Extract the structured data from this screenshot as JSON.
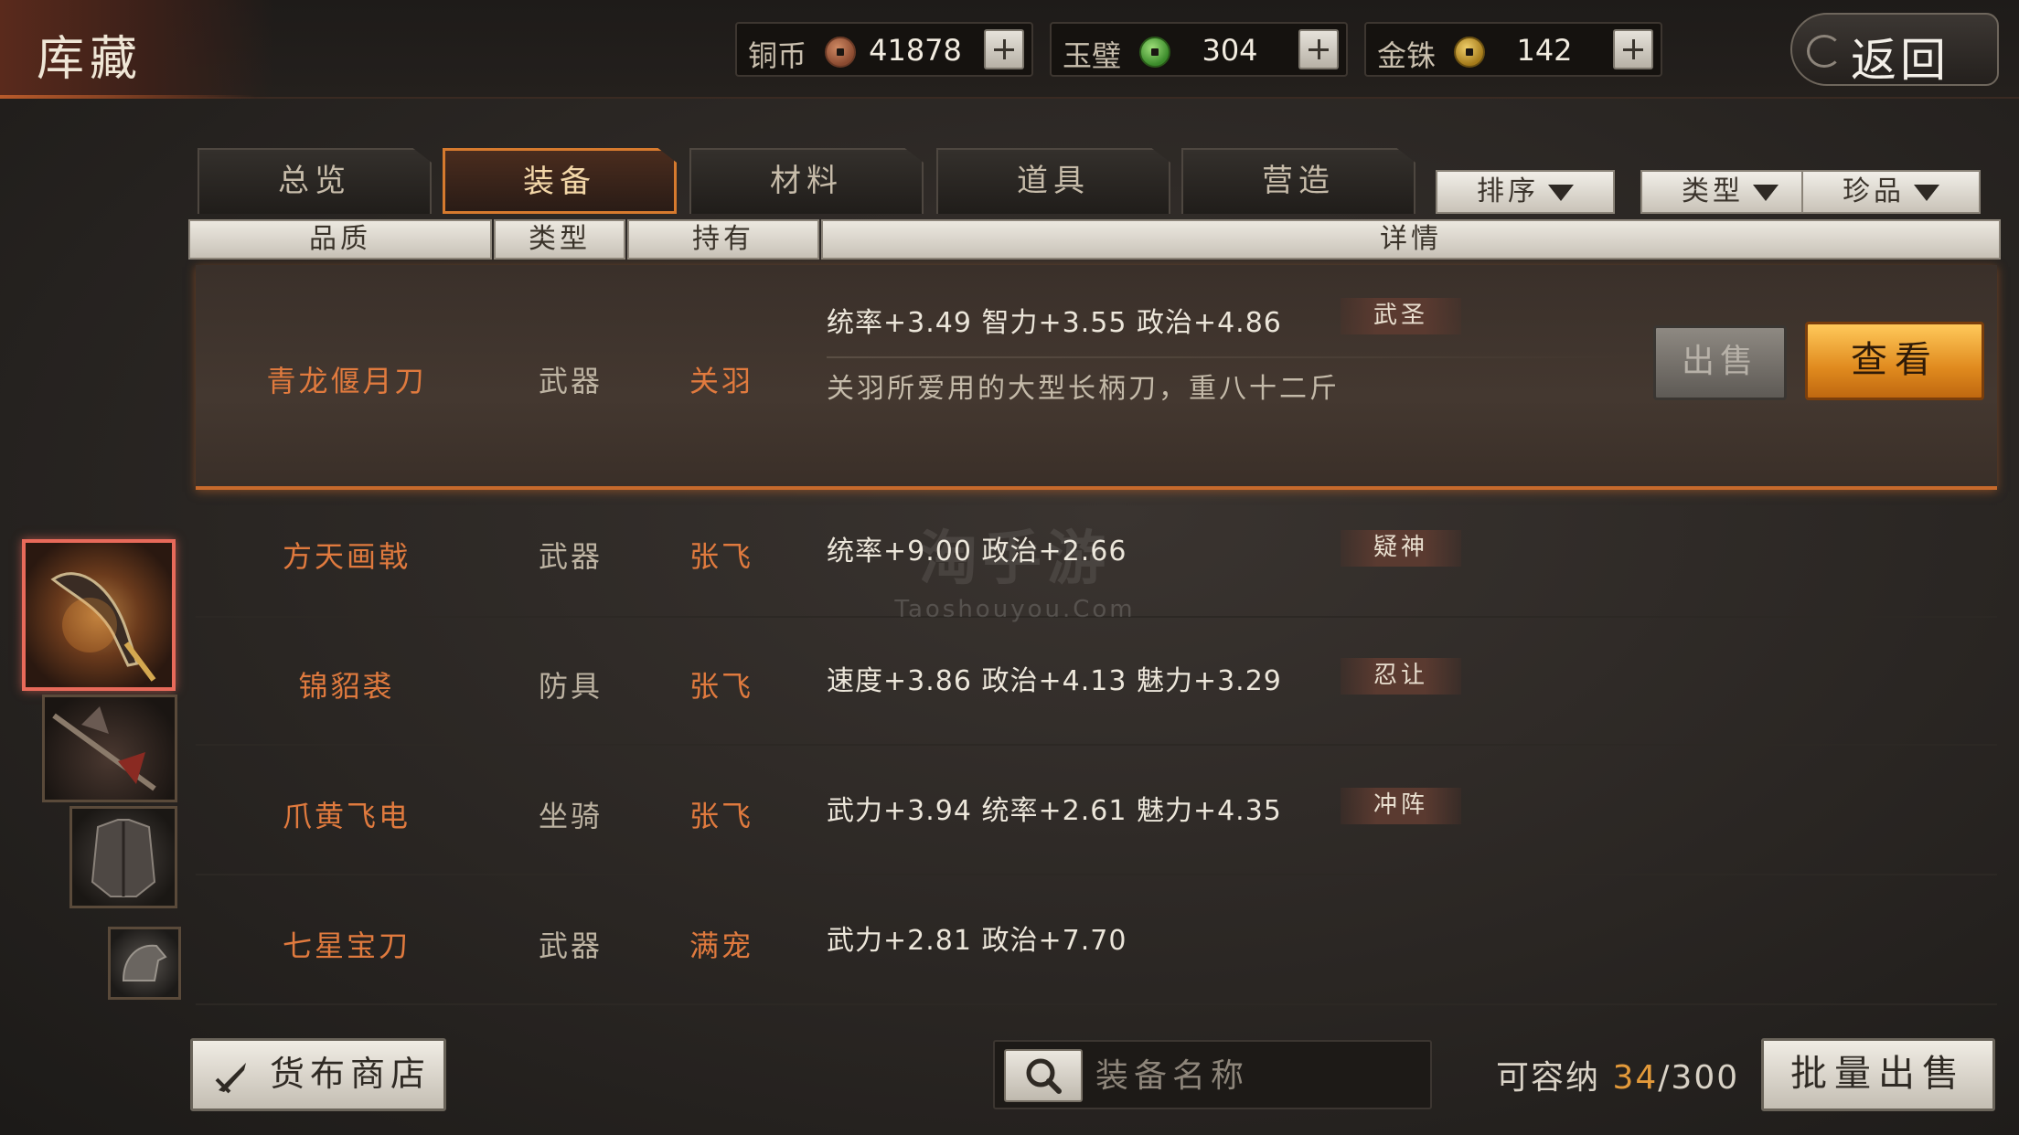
{
  "header": {
    "title": "库藏",
    "back_label": "返回",
    "currencies": [
      {
        "label": "铜币",
        "value": "41878",
        "icon": "copper-coin-icon"
      },
      {
        "label": "玉璧",
        "value": "304",
        "icon": "jade-coin-icon"
      },
      {
        "label": "金铢",
        "value": "142",
        "icon": "gold-coin-icon"
      }
    ]
  },
  "tabs": [
    {
      "label": "总览",
      "active": false
    },
    {
      "label": "装备",
      "active": true
    },
    {
      "label": "材料",
      "active": false
    },
    {
      "label": "道具",
      "active": false
    },
    {
      "label": "营造",
      "active": false
    }
  ],
  "filters": [
    {
      "label": "排序"
    },
    {
      "label": "类型"
    },
    {
      "label": "珍品"
    }
  ],
  "columns": {
    "quality": "品质",
    "type": "类型",
    "owner": "持有",
    "detail": "详情"
  },
  "items": [
    {
      "name": "青龙偃月刀",
      "type": "武器",
      "owner": "关羽",
      "stats": "统率+3.49  智力+3.55  政治+4.86",
      "tag": "武圣",
      "desc": "关羽所爱用的大型长柄刀，重八十二斤",
      "selected": true
    },
    {
      "name": "方天画戟",
      "type": "武器",
      "owner": "张飞",
      "stats": "统率+9.00  政治+2.66",
      "tag": "疑神"
    },
    {
      "name": "锦貂裘",
      "type": "防具",
      "owner": "张飞",
      "stats": "速度+3.86  政治+4.13  魅力+3.29",
      "tag": "忍让"
    },
    {
      "name": "爪黄飞电",
      "type": "坐骑",
      "owner": "张飞",
      "stats": "武力+3.94  统率+2.61  魅力+4.35",
      "tag": "冲阵"
    },
    {
      "name": "七星宝刀",
      "type": "武器",
      "owner": "满宠",
      "stats": "武力+2.81  政治+7.70",
      "tag": ""
    }
  ],
  "actions": {
    "sell_label": "出售",
    "view_label": "查看"
  },
  "footer": {
    "shop_label": "货布商店",
    "search_placeholder": "装备名称",
    "capacity_label": "可容纳",
    "capacity_used": "34",
    "capacity_total": "/300",
    "batch_sell_label": "批量出售"
  },
  "watermark": {
    "cn": "淘手游",
    "en": "Taoshouyou.Com"
  },
  "colors": {
    "accent_orange": "#e07a3e",
    "selected_border": "#c76a2c",
    "view_button": "#e08a1e"
  }
}
